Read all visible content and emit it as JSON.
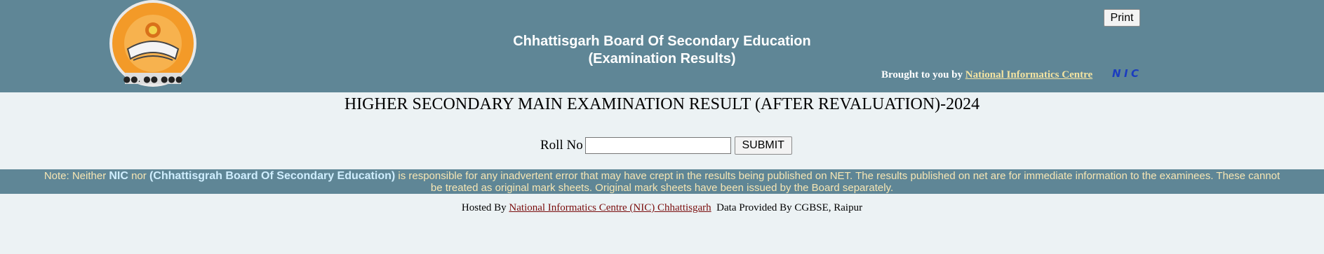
{
  "header": {
    "title_line1": "Chhattisgarh Board Of Secondary Education",
    "title_line2": "(Examination Results)",
    "print_label": "Print",
    "brought_prefix": "Brought to you by ",
    "brought_link": "National Informatics Centre",
    "logo_icon": "cgbse-seal-logo",
    "nic_logo": "nic-logo-icon"
  },
  "main": {
    "exam_title": "HIGHER SECONDARY MAIN EXAMINATION RESULT (AFTER REVALUATION)-2024",
    "roll_label": "Roll No",
    "roll_value": "",
    "submit_label": "SUBMIT"
  },
  "note": {
    "prefix": "Note: Neither ",
    "nic": "NIC",
    "nor": " nor ",
    "board": "(Chhattisgrah Board Of Secondary Education)",
    "rest": " is responsible for any inadvertent error that may have crept in the results being published on NET. The results published on net are for immediate information to the examinees. These cannot be treated as original mark sheets. Original mark sheets have been issued by the Board separately."
  },
  "footer": {
    "hosted_prefix": "Hosted By ",
    "hosted_link": "National Informatics Centre (NIC) Chhattisgarh",
    "data_text": "  Data Provided By CGBSE, Raipur"
  },
  "colors": {
    "header_bg": "#5f8696",
    "page_bg": "#ecf2f4",
    "note_text": "#f6e6b4",
    "link_footer": "#7a0d0d"
  }
}
